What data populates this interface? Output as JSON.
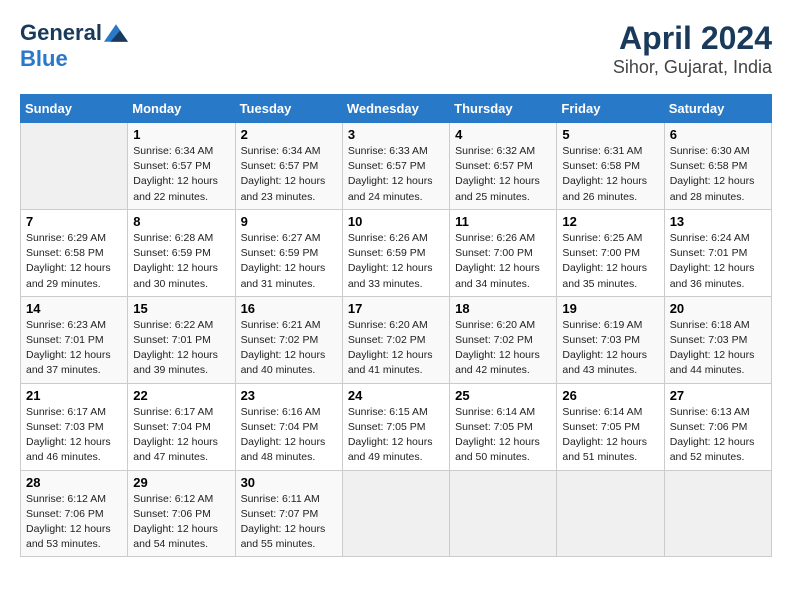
{
  "header": {
    "logo_general": "General",
    "logo_blue": "Blue",
    "title": "April 2024",
    "subtitle": "Sihor, Gujarat, India"
  },
  "calendar": {
    "weekdays": [
      "Sunday",
      "Monday",
      "Tuesday",
      "Wednesday",
      "Thursday",
      "Friday",
      "Saturday"
    ],
    "weeks": [
      [
        {
          "day": "",
          "info": ""
        },
        {
          "day": "1",
          "info": "Sunrise: 6:34 AM\nSunset: 6:57 PM\nDaylight: 12 hours\nand 22 minutes."
        },
        {
          "day": "2",
          "info": "Sunrise: 6:34 AM\nSunset: 6:57 PM\nDaylight: 12 hours\nand 23 minutes."
        },
        {
          "day": "3",
          "info": "Sunrise: 6:33 AM\nSunset: 6:57 PM\nDaylight: 12 hours\nand 24 minutes."
        },
        {
          "day": "4",
          "info": "Sunrise: 6:32 AM\nSunset: 6:57 PM\nDaylight: 12 hours\nand 25 minutes."
        },
        {
          "day": "5",
          "info": "Sunrise: 6:31 AM\nSunset: 6:58 PM\nDaylight: 12 hours\nand 26 minutes."
        },
        {
          "day": "6",
          "info": "Sunrise: 6:30 AM\nSunset: 6:58 PM\nDaylight: 12 hours\nand 28 minutes."
        }
      ],
      [
        {
          "day": "7",
          "info": "Sunrise: 6:29 AM\nSunset: 6:58 PM\nDaylight: 12 hours\nand 29 minutes."
        },
        {
          "day": "8",
          "info": "Sunrise: 6:28 AM\nSunset: 6:59 PM\nDaylight: 12 hours\nand 30 minutes."
        },
        {
          "day": "9",
          "info": "Sunrise: 6:27 AM\nSunset: 6:59 PM\nDaylight: 12 hours\nand 31 minutes."
        },
        {
          "day": "10",
          "info": "Sunrise: 6:26 AM\nSunset: 6:59 PM\nDaylight: 12 hours\nand 33 minutes."
        },
        {
          "day": "11",
          "info": "Sunrise: 6:26 AM\nSunset: 7:00 PM\nDaylight: 12 hours\nand 34 minutes."
        },
        {
          "day": "12",
          "info": "Sunrise: 6:25 AM\nSunset: 7:00 PM\nDaylight: 12 hours\nand 35 minutes."
        },
        {
          "day": "13",
          "info": "Sunrise: 6:24 AM\nSunset: 7:01 PM\nDaylight: 12 hours\nand 36 minutes."
        }
      ],
      [
        {
          "day": "14",
          "info": "Sunrise: 6:23 AM\nSunset: 7:01 PM\nDaylight: 12 hours\nand 37 minutes."
        },
        {
          "day": "15",
          "info": "Sunrise: 6:22 AM\nSunset: 7:01 PM\nDaylight: 12 hours\nand 39 minutes."
        },
        {
          "day": "16",
          "info": "Sunrise: 6:21 AM\nSunset: 7:02 PM\nDaylight: 12 hours\nand 40 minutes."
        },
        {
          "day": "17",
          "info": "Sunrise: 6:20 AM\nSunset: 7:02 PM\nDaylight: 12 hours\nand 41 minutes."
        },
        {
          "day": "18",
          "info": "Sunrise: 6:20 AM\nSunset: 7:02 PM\nDaylight: 12 hours\nand 42 minutes."
        },
        {
          "day": "19",
          "info": "Sunrise: 6:19 AM\nSunset: 7:03 PM\nDaylight: 12 hours\nand 43 minutes."
        },
        {
          "day": "20",
          "info": "Sunrise: 6:18 AM\nSunset: 7:03 PM\nDaylight: 12 hours\nand 44 minutes."
        }
      ],
      [
        {
          "day": "21",
          "info": "Sunrise: 6:17 AM\nSunset: 7:03 PM\nDaylight: 12 hours\nand 46 minutes."
        },
        {
          "day": "22",
          "info": "Sunrise: 6:17 AM\nSunset: 7:04 PM\nDaylight: 12 hours\nand 47 minutes."
        },
        {
          "day": "23",
          "info": "Sunrise: 6:16 AM\nSunset: 7:04 PM\nDaylight: 12 hours\nand 48 minutes."
        },
        {
          "day": "24",
          "info": "Sunrise: 6:15 AM\nSunset: 7:05 PM\nDaylight: 12 hours\nand 49 minutes."
        },
        {
          "day": "25",
          "info": "Sunrise: 6:14 AM\nSunset: 7:05 PM\nDaylight: 12 hours\nand 50 minutes."
        },
        {
          "day": "26",
          "info": "Sunrise: 6:14 AM\nSunset: 7:05 PM\nDaylight: 12 hours\nand 51 minutes."
        },
        {
          "day": "27",
          "info": "Sunrise: 6:13 AM\nSunset: 7:06 PM\nDaylight: 12 hours\nand 52 minutes."
        }
      ],
      [
        {
          "day": "28",
          "info": "Sunrise: 6:12 AM\nSunset: 7:06 PM\nDaylight: 12 hours\nand 53 minutes."
        },
        {
          "day": "29",
          "info": "Sunrise: 6:12 AM\nSunset: 7:06 PM\nDaylight: 12 hours\nand 54 minutes."
        },
        {
          "day": "30",
          "info": "Sunrise: 6:11 AM\nSunset: 7:07 PM\nDaylight: 12 hours\nand 55 minutes."
        },
        {
          "day": "",
          "info": ""
        },
        {
          "day": "",
          "info": ""
        },
        {
          "day": "",
          "info": ""
        },
        {
          "day": "",
          "info": ""
        }
      ]
    ]
  }
}
